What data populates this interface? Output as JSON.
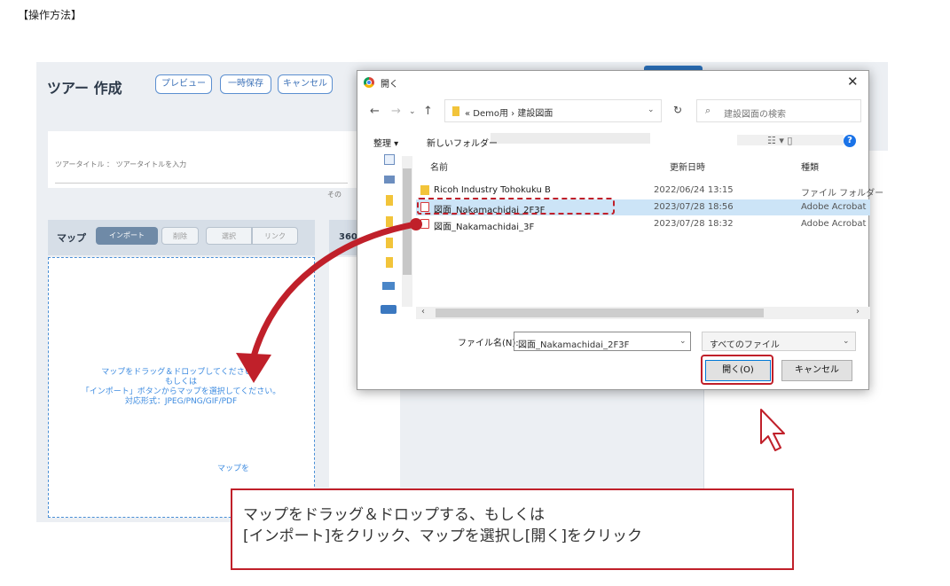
{
  "heading": "【操作方法】",
  "app": {
    "title": "ツアー 作成",
    "toolbar": {
      "preview": "プレビュー",
      "save": "一時保存",
      "cancel": "キャンセル"
    },
    "tour_title_label": "ツアータイトル ： ツアータイトルを入力",
    "other_label": "その",
    "map": {
      "label": "マップ",
      "buttons": {
        "import": "インポート",
        "delete": "削除",
        "select": "選択",
        "link": "リンク"
      },
      "drop_text": [
        "マップをドラッグ＆ドロップしてください。",
        "もしくは",
        "「インポート」ボタンからマップを選択してください。",
        "対応形式：JPEG/PNG/GIF/PDF"
      ],
      "drop_tail": "マップを"
    },
    "panel360_label": "360"
  },
  "dialog": {
    "title": "開く",
    "close": "✕",
    "breadcrumb": "« Demo用 › 建設図面",
    "search_placeholder": "建設図面の検索",
    "organize": "整理 ▾",
    "new_folder": "新しいフォルダー",
    "columns": {
      "name": "名前",
      "date": "更新日時",
      "type": "種類"
    },
    "files": [
      {
        "name": "Ricoh Industry Tohokuku B",
        "date": "2022/06/24 13:15",
        "type": "ファイル フォルダー",
        "icon": "folder",
        "selected": false
      },
      {
        "name": "図面_Nakamachidai_2F3F",
        "date": "2023/07/28 18:56",
        "type": "Adobe Acrobat",
        "icon": "pdf",
        "selected": true
      },
      {
        "name": "図面_Nakamachidai_3F",
        "date": "2023/07/28 18:32",
        "type": "Adobe Acrobat",
        "icon": "pdf",
        "selected": false
      }
    ],
    "file_name_label": "ファイル名(N):",
    "file_name_value": "図面_Nakamachidai_2F3F",
    "file_type_value": "すべてのファイル",
    "open_button": "開く(O)",
    "cancel_button": "キャンセル"
  },
  "callout": {
    "lines": [
      "マップをドラッグ＆ドロップする、もしくは",
      "[インポート]をクリック、マップを選択し[開く]をクリック"
    ]
  },
  "colors": {
    "annotation": "#c0202a",
    "accent": "#3d8be0",
    "selection": "#cce4f7"
  }
}
